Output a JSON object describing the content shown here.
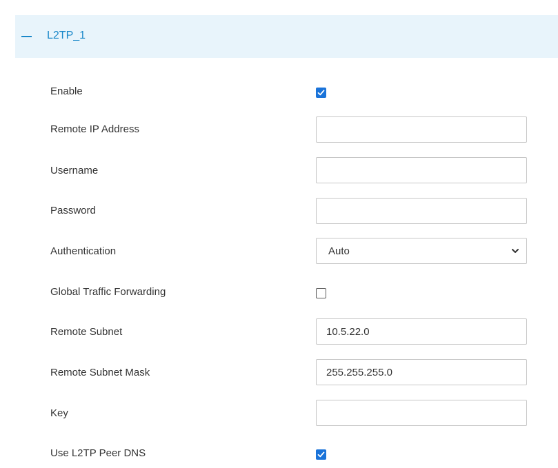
{
  "section": {
    "title": "L2TP_1",
    "collapse_icon": "minus-icon"
  },
  "fields": {
    "enable": {
      "label": "Enable",
      "checked": true
    },
    "remote_ip": {
      "label": "Remote IP Address",
      "value": ""
    },
    "username": {
      "label": "Username",
      "value": ""
    },
    "password": {
      "label": "Password",
      "value": ""
    },
    "authentication": {
      "label": "Authentication",
      "value": "Auto"
    },
    "global_traffic_forwarding": {
      "label": "Global Traffic Forwarding",
      "checked": false
    },
    "remote_subnet": {
      "label": "Remote Subnet",
      "value": "10.5.22.0"
    },
    "remote_subnet_mask": {
      "label": "Remote Subnet Mask",
      "value": "255.255.255.0"
    },
    "key": {
      "label": "Key",
      "value": ""
    },
    "use_peer_dns": {
      "label": "Use L2TP Peer DNS",
      "checked": true
    }
  },
  "colors": {
    "accent": "#1a88c9",
    "header_bg": "#e8f4fb",
    "checkbox_checked": "#1a73d9"
  }
}
